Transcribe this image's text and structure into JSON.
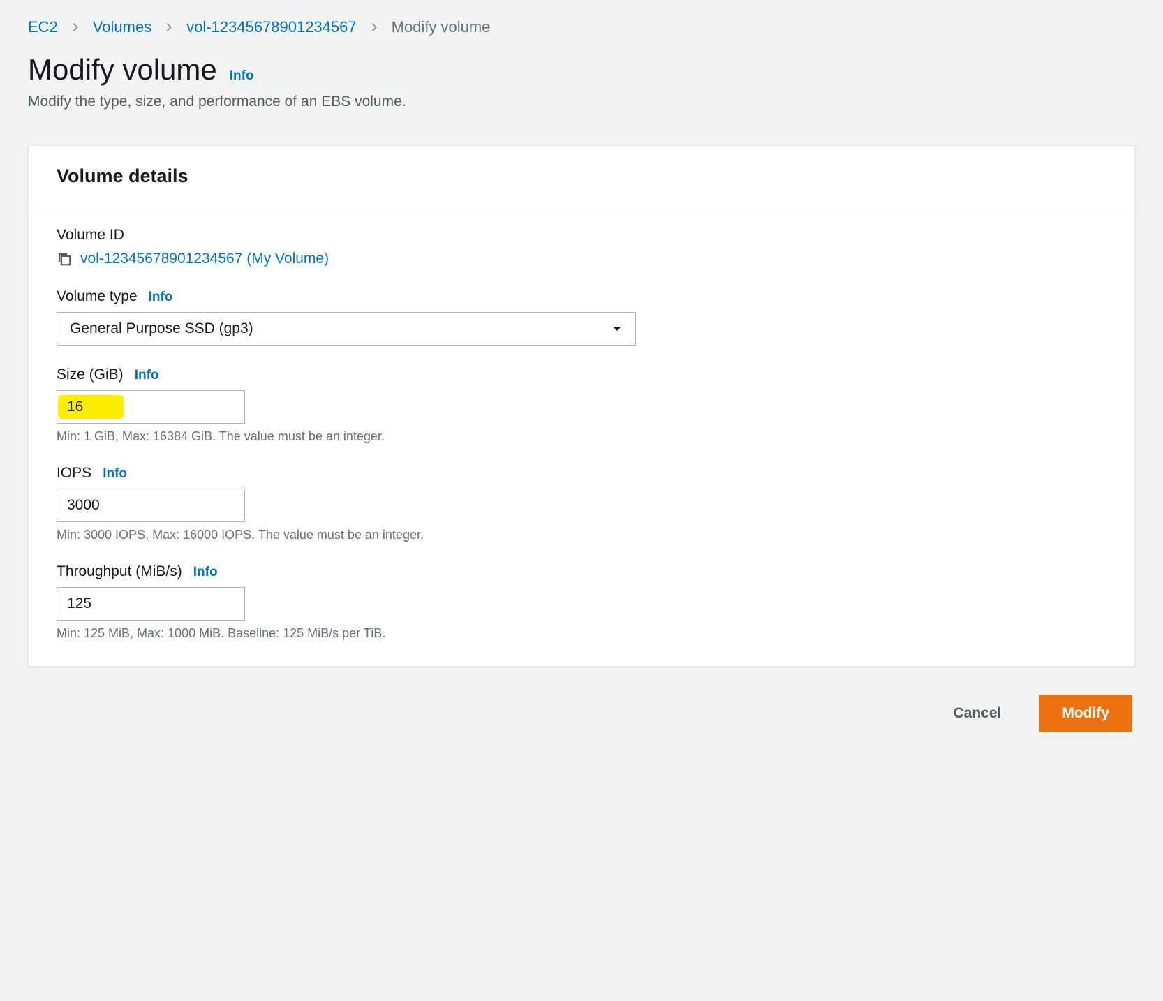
{
  "breadcrumb": {
    "items": [
      "EC2",
      "Volumes",
      "vol-12345678901234567"
    ],
    "current": "Modify volume"
  },
  "header": {
    "title": "Modify volume",
    "info": "Info",
    "description": "Modify the type, size, and performance of an EBS volume."
  },
  "panel": {
    "title": "Volume details",
    "volume_id": {
      "label": "Volume ID",
      "value": "vol-12345678901234567 (My Volume)"
    },
    "volume_type": {
      "label": "Volume type",
      "info": "Info",
      "value": "General Purpose SSD (gp3)"
    },
    "size": {
      "label": "Size (GiB)",
      "info": "Info",
      "value": "16",
      "hint": "Min: 1 GiB, Max: 16384 GiB. The value must be an integer."
    },
    "iops": {
      "label": "IOPS",
      "info": "Info",
      "value": "3000",
      "hint": "Min: 3000 IOPS, Max: 16000 IOPS. The value must be an integer."
    },
    "throughput": {
      "label": "Throughput (MiB/s)",
      "info": "Info",
      "value": "125",
      "hint": "Min: 125 MiB, Max: 1000 MiB. Baseline: 125 MiB/s per TiB."
    }
  },
  "actions": {
    "cancel": "Cancel",
    "submit": "Modify"
  }
}
